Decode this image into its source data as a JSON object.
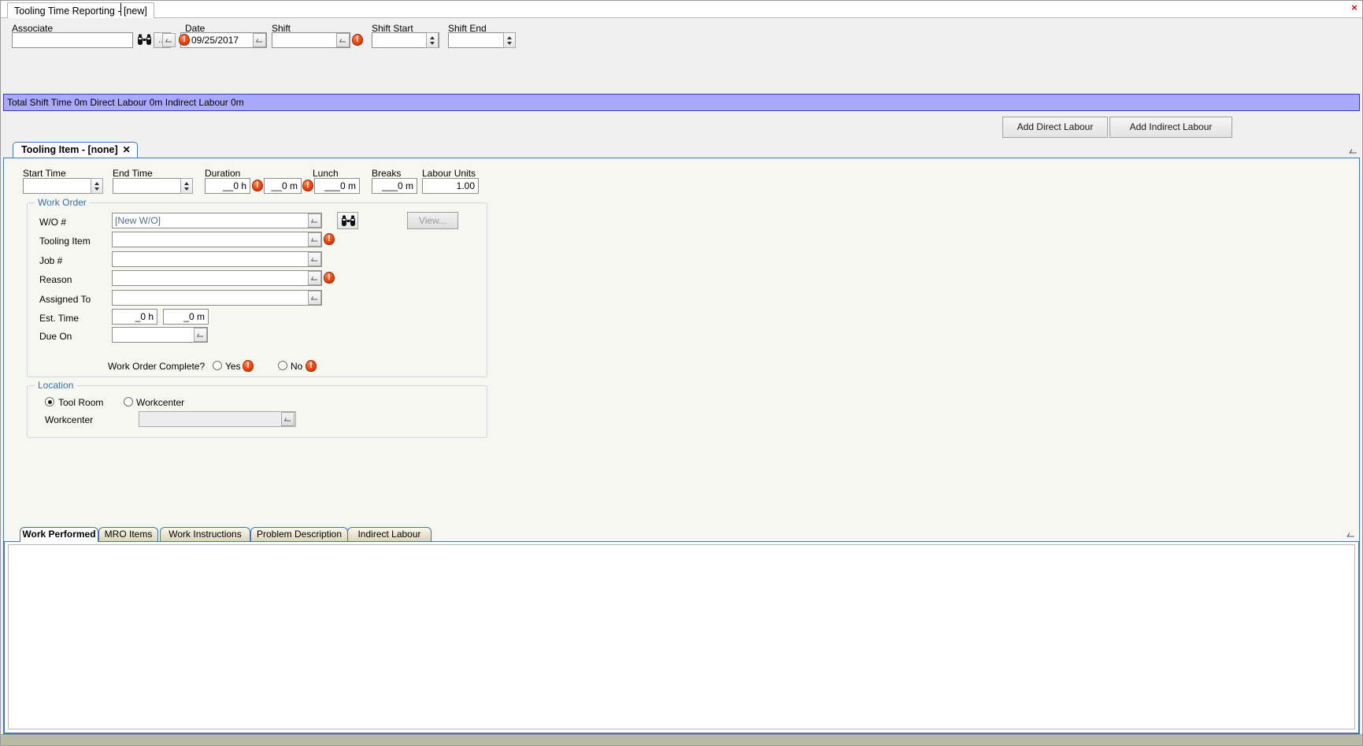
{
  "window": {
    "document_tab": "Tooling Time Reporting - [new]",
    "close_label": "×"
  },
  "header": {
    "associate": {
      "label": "Associate",
      "value": "",
      "search_icon": "binoculars-icon",
      "ellipsis_label": "...",
      "dropdown_icon": "chevron-down-icon"
    },
    "date": {
      "label": "Date",
      "value": "09/25/2017",
      "error_icon": "error-icon",
      "dropdown_icon": "chevron-down-icon"
    },
    "shift": {
      "label": "Shift",
      "value": "",
      "error_icon": "error-icon",
      "dropdown_icon": "chevron-down-icon"
    },
    "shift_start": {
      "label": "Shift Start",
      "value": "",
      "spinner_icon": "spinner-icon"
    },
    "shift_end": {
      "label": "Shift End",
      "value": "",
      "spinner_icon": "spinner-icon"
    }
  },
  "summary": {
    "text": "Total Shift Time 0m  Direct Labour 0m  Indirect Labour 0m",
    "bg_color": "#a9a9ff"
  },
  "actions": {
    "add_direct_labour": "Add Direct Labour",
    "add_indirect_labour": "Add Indirect Labour"
  },
  "item_tab": {
    "title": "Tooling Item - [none]",
    "close": "✕",
    "scroll_icon": "chevron-down-icon"
  },
  "times": {
    "start_time": {
      "label": "Start Time",
      "value": ""
    },
    "end_time": {
      "label": "End Time",
      "value": ""
    },
    "duration": {
      "label": "Duration",
      "hours": "__0 h",
      "minutes": "__0 m"
    },
    "lunch": {
      "label": "Lunch",
      "value": "___0 m"
    },
    "breaks": {
      "label": "Breaks",
      "value": "___0 m"
    },
    "labour_units": {
      "label": "Labour Units",
      "value": "1.00"
    }
  },
  "work_order": {
    "title": "Work Order",
    "wo_number": {
      "label": "W/O #",
      "value": "[New W/O]"
    },
    "search_icon": "binoculars-icon",
    "view_button": "View...",
    "tooling_item": {
      "label": "Tooling Item",
      "value": ""
    },
    "job_number": {
      "label": "Job #",
      "value": ""
    },
    "reason": {
      "label": "Reason",
      "value": ""
    },
    "assigned_to": {
      "label": "Assigned To",
      "value": ""
    },
    "est_time": {
      "label": "Est. Time",
      "hours": "_0 h",
      "minutes": "_0 m"
    },
    "due_on": {
      "label": "Due On",
      "value": ""
    },
    "complete": {
      "label": "Work Order Complete?",
      "yes": "Yes",
      "no": "No",
      "selected": ""
    }
  },
  "location": {
    "title": "Location",
    "tool_room": "Tool Room",
    "workcenter_radio": "Workcenter",
    "workcenter_label": "Workcenter",
    "workcenter_value": "",
    "selected": "tool_room"
  },
  "bottom_tabs": {
    "items": [
      {
        "label": "Work Performed",
        "active": true
      },
      {
        "label": "MRO Items",
        "active": false
      },
      {
        "label": "Work Instructions",
        "active": false
      },
      {
        "label": "Problem Description",
        "active": false
      },
      {
        "label": "Indirect Labour",
        "active": false
      }
    ],
    "editor_value": "",
    "scroll_icon": "chevron-down-icon"
  }
}
